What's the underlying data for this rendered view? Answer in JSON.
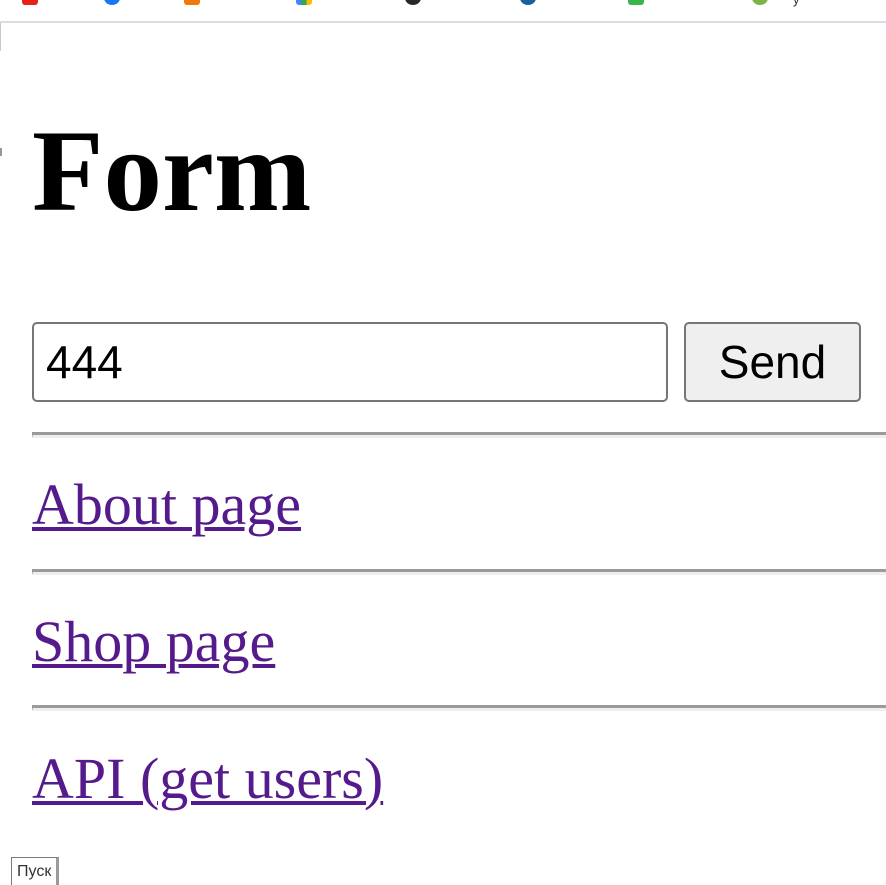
{
  "bookmarks_bar": {
    "icons": [
      {
        "name": "youtube-bookmark-icon",
        "color": "#e62117"
      },
      {
        "name": "messenger-bookmark-icon",
        "color": "#1877f2"
      },
      {
        "name": "orange-bookmark-icon",
        "color": "#f2760c"
      },
      {
        "name": "colorful-bookmark-icon",
        "color": "#4caf50"
      },
      {
        "name": "github-bookmark-icon",
        "color": "#24292e"
      },
      {
        "name": "blue-bookmark-icon",
        "color": "#1a5fa0"
      },
      {
        "name": "green-bookmark-icon",
        "color": "#3ab54a"
      },
      {
        "name": "lime-bookmark-icon",
        "color": "#7cb342"
      }
    ],
    "truncated_label": "у"
  },
  "page": {
    "title": "Form",
    "form": {
      "input_value": "444",
      "submit_label": "Send"
    },
    "links": [
      {
        "label": "About page"
      },
      {
        "label": "Shop page"
      },
      {
        "label": "API (get users)"
      }
    ]
  },
  "taskbar": {
    "start_label": "Пуск"
  },
  "colors": {
    "link": "#551a8b",
    "button_bg": "#efefef",
    "border": "#767676"
  }
}
